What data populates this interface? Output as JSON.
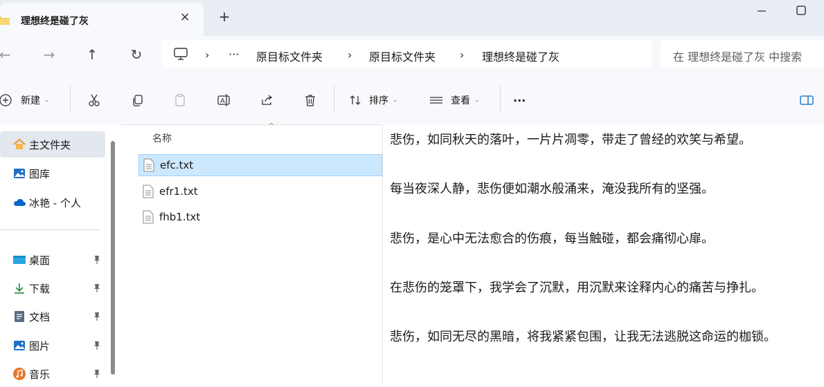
{
  "window": {
    "tab_title": "理想终是碰了灰",
    "tab_close": "×",
    "new_tab": "+"
  },
  "nav": {
    "back": "←",
    "forward": "→",
    "up": "↑",
    "refresh": "↻"
  },
  "address": {
    "separator": "›",
    "more": "···",
    "crumbs": [
      "原目标文件夹",
      "原目标文件夹",
      "理想终是碰了灰"
    ]
  },
  "search": {
    "placeholder": "在 理想终是碰了灰 中搜索"
  },
  "toolbar": {
    "new_label": "新建",
    "sort_label": "排序",
    "view_label": "查看",
    "more_label": "···",
    "chevron": "⌄"
  },
  "sidebar": {
    "items": [
      {
        "label": "主文件夹",
        "icon": "home-icon"
      },
      {
        "label": "图库",
        "icon": "gallery-icon"
      },
      {
        "label": "冰艳 - 个人",
        "icon": "cloud-icon"
      },
      {
        "label": "桌面",
        "icon": "desktop-icon"
      },
      {
        "label": "下载",
        "icon": "download-icon"
      },
      {
        "label": "文档",
        "icon": "document-icon"
      },
      {
        "label": "图片",
        "icon": "pictures-icon"
      },
      {
        "label": "音乐",
        "icon": "music-icon"
      }
    ],
    "pin_glyph": "📌"
  },
  "filelist": {
    "column_name": "名称",
    "sort_caret": "^",
    "files": [
      "efc.txt",
      "efr1.txt",
      "fhb1.txt"
    ]
  },
  "preview": {
    "lines": [
      "悲伤，如同秋天的落叶，一片片凋零，带走了曾经的欢笑与希望。",
      "每当夜深人静，悲伤便如潮水般涌来，淹没我所有的坚强。",
      "悲伤，是心中无法愈合的伤痕，每当触碰，都会痛彻心扉。",
      "在悲伤的笼罩下，我学会了沉默，用沉默来诠释内心的痛苦与挣扎。",
      "悲伤，如同无尽的黑暗，将我紧紧包围，让我无法逃脱这命运的枷锁。"
    ]
  },
  "colors": {
    "accent": "#0067c0",
    "selection": "#cce8ff",
    "titlebar": "#e9eef5"
  }
}
